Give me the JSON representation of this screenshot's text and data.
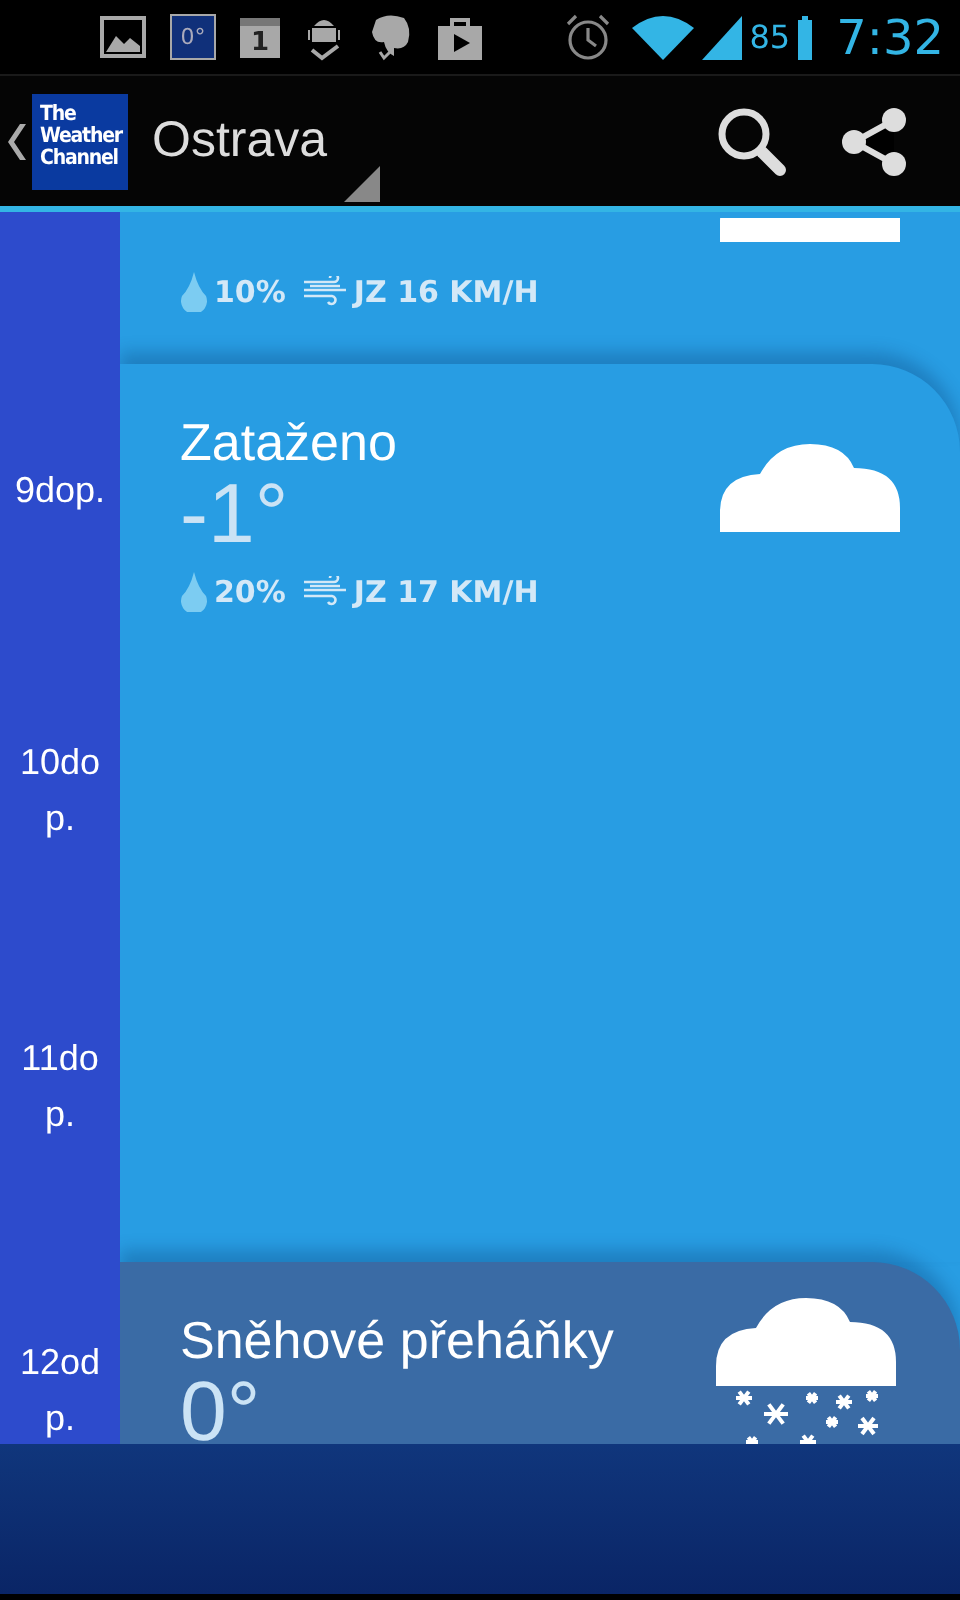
{
  "status_bar": {
    "notifications": [
      {
        "kind": "image"
      },
      {
        "kind": "temperature",
        "text": "0°"
      },
      {
        "kind": "calendar",
        "text": "1"
      },
      {
        "kind": "download"
      },
      {
        "kind": "elephant"
      },
      {
        "kind": "store"
      }
    ],
    "battery": "85",
    "time": "7:32"
  },
  "action_bar": {
    "logo": "The Weather Channel",
    "title": "Ostrava"
  },
  "timeline": [
    "9dop.",
    "10dop.",
    "11dop.",
    "12odp."
  ],
  "forecasts": [
    {
      "kind": "cloudy",
      "color": "#289de3",
      "precip": "10%",
      "wind": "JZ 16 KM/H"
    },
    {
      "kind": "cloudy",
      "color": "#289de3",
      "condition": "Zataženo",
      "temp": "-1°",
      "precip": "20%",
      "wind": "JZ 17 KM/H"
    },
    {
      "kind": "snow",
      "color": "#3a6ba5",
      "condition": "Sněhové přeháňky",
      "temp": "0°"
    }
  ]
}
